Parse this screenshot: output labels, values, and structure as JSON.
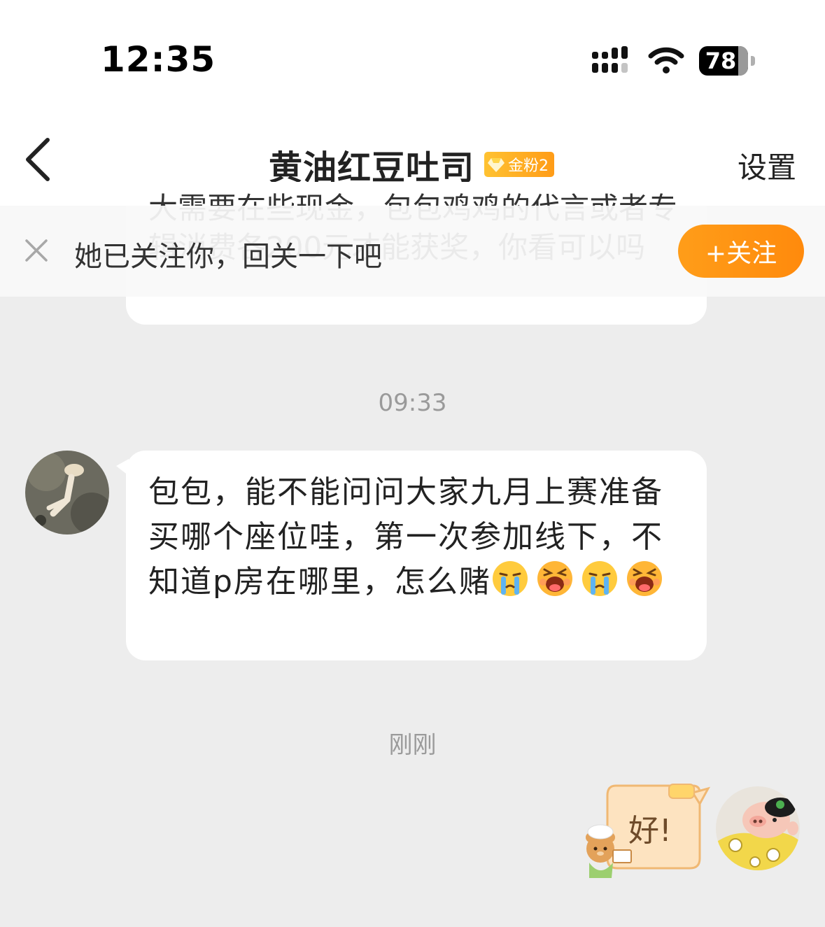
{
  "status_bar": {
    "time": "12:35",
    "battery": "78"
  },
  "header": {
    "title": "黄油红豆吐司",
    "badge": "金粉2",
    "settings": "设置"
  },
  "previous_message": {
    "text": "大需要在些现金，包包鸡鸡的代言或者专辑消费各200元才能获奖，你看可以吗"
  },
  "follow_bar": {
    "text": "她已关注你，回关一下吧",
    "button": "+关注"
  },
  "timestamps": {
    "first": "09:33",
    "second": "刚刚"
  },
  "message": {
    "text": "包包，能不能问问大家九月上赛准备买哪个座位哇，第一次参加线下，不知道p房在哪里，怎么赌",
    "emojis": [
      "crying-emoji",
      "yelling-emoji",
      "crying-emoji",
      "yelling-emoji"
    ]
  },
  "reply": {
    "sticker_text": "好!"
  },
  "colors": {
    "accent": "#ff9512",
    "background": "#ededed",
    "badge": "#ffb020"
  }
}
